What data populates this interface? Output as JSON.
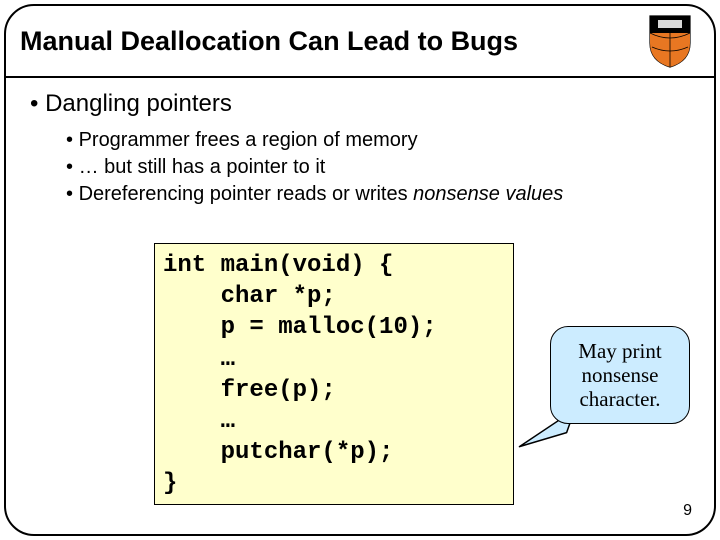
{
  "title": "Manual Deallocation Can Lead to Bugs",
  "bullets": {
    "l1": "Dangling pointers",
    "l2a": "Programmer frees a region of memory",
    "l2b": "… but still has a pointer to it",
    "l2c_prefix": "Dereferencing pointer reads or writes ",
    "l2c_italic": "nonsense values"
  },
  "code": "int main(void) {\n    char *p;\n    p = malloc(10);\n    …\n    free(p);\n    …\n    putchar(*p);\n}",
  "callout": "May print nonsense character.",
  "page_number": "9",
  "shield_label": "princeton-shield"
}
